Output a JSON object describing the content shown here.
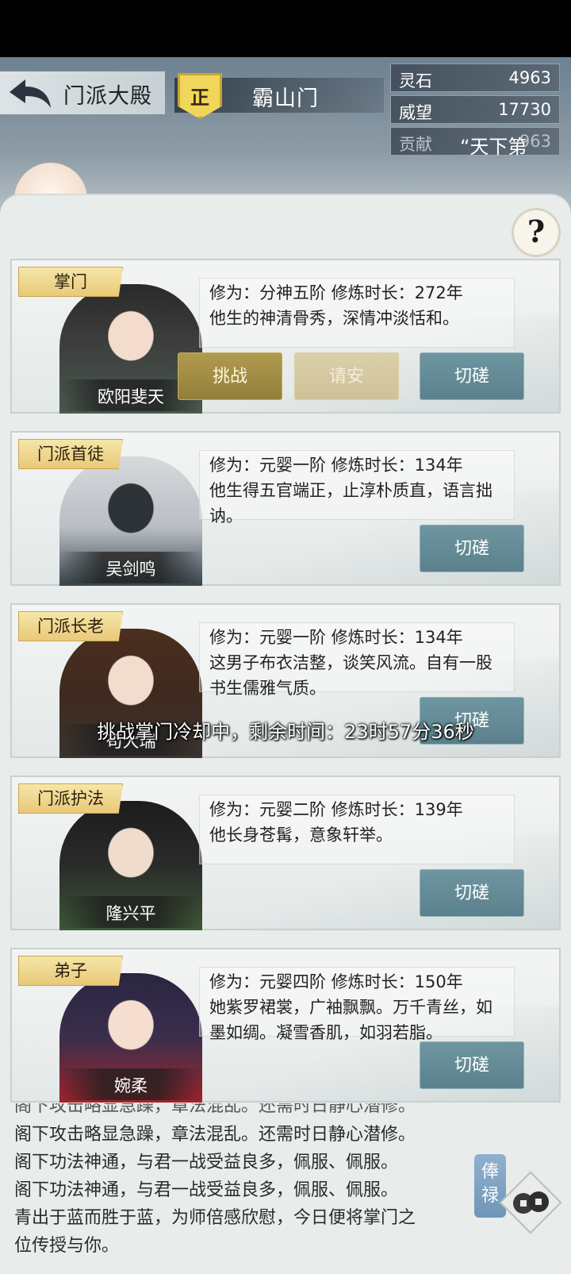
{
  "header": {
    "hall_title": "门派大殿",
    "alignment_badge": "正",
    "sect_name": "霸山门",
    "floating_text": "“天下第"
  },
  "stats": [
    {
      "label": "灵石",
      "value": "4963"
    },
    {
      "label": "威望",
      "value": "17730"
    },
    {
      "label": "贡献",
      "value": "963"
    }
  ],
  "help_label": "?",
  "members": [
    {
      "rank": "掌门",
      "name": "欧阳斐天",
      "cultivation": "修为：分神五阶  修炼时长：272年",
      "description": "他生的神清骨秀，深情冲淡恬和。",
      "buttons": [
        "挑战",
        "请安",
        "切磋"
      ]
    },
    {
      "rank": "门派首徒",
      "name": "吴剑鸣",
      "cultivation": "修为：元婴一阶  修炼时长：134年",
      "description": "他生得五官端正，止淳朴质直，语言拙讷。",
      "buttons": [
        "切磋"
      ]
    },
    {
      "rank": "门派长老",
      "name": "苟大瑞",
      "cultivation": "修为：元婴一阶  修炼时长：134年",
      "description": "这男子布衣洁整，谈笑风流。自有一股书生儒雅气质。",
      "buttons": [
        "切磋"
      ]
    },
    {
      "rank": "门派护法",
      "name": "隆兴平",
      "cultivation": "修为：元婴二阶  修炼时长：139年",
      "description": "他长身苍髯，意象轩举。",
      "buttons": [
        "切磋"
      ]
    },
    {
      "rank": "弟子",
      "name": "婉柔",
      "cultivation": "修为：元婴四阶  修炼时长：150年",
      "description": "她紫罗裙裳，广袖飘飘。万千青丝，如墨如绸。凝雪香肌，如羽若脂。",
      "buttons": [
        "切磋"
      ]
    }
  ],
  "toast": "挑战掌门冷却中，剩余时间：23时57分36秒",
  "log": [
    "阁下攻击略显急躁，章法混乱。还需时日静心潜修。",
    "阁下攻击略显急躁，章法混乱。还需时日静心潜修。",
    "阁下功法神通，与君一战受益良多，佩服、佩服。",
    "阁下功法神通，与君一战受益良多，佩服、佩服。",
    "青出于蓝而胜于蓝，为师倍感欣慰，今日便将掌门之",
    "位传授与你。"
  ],
  "salary_label": "俸禄",
  "icons": {
    "back": "back-arrow-icon",
    "help": "question-icon",
    "coin": "coin-icon"
  }
}
